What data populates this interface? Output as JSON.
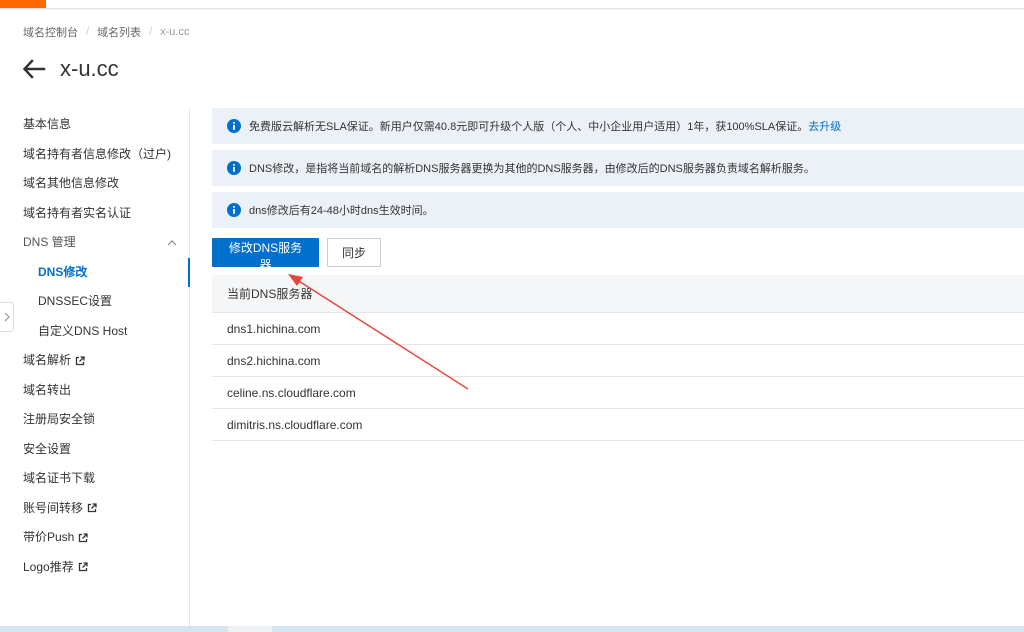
{
  "breadcrumb": {
    "items": [
      "域名控制台",
      "域名列表",
      "x-u.cc"
    ]
  },
  "page": {
    "title": "x-u.cc"
  },
  "sidebar": {
    "items": [
      {
        "label": "基本信息"
      },
      {
        "label": "域名持有者信息修改（过户)"
      },
      {
        "label": "域名其他信息修改"
      },
      {
        "label": "域名持有者实名认证"
      },
      {
        "label": "DNS 管理"
      },
      {
        "label": "DNS修改"
      },
      {
        "label": "DNSSEC设置"
      },
      {
        "label": "自定义DNS Host"
      },
      {
        "label": "域名解析"
      },
      {
        "label": "域名转出"
      },
      {
        "label": "注册局安全锁"
      },
      {
        "label": "安全设置"
      },
      {
        "label": "域名证书下载"
      },
      {
        "label": "账号间转移"
      },
      {
        "label": "带价Push"
      },
      {
        "label": "Logo推荐"
      }
    ]
  },
  "notices": {
    "n1_text": "免费版云解析无SLA保证。新用户仅需40.8元即可升级个人版（个人、中小企业用户适用）1年，获100%SLA保证。",
    "n1_link": "去升级",
    "n2_text": "DNS修改，是指将当前域名的解析DNS服务器更换为其他的DNS服务器，由修改后的DNS服务器负责域名解析服务。",
    "n3_text": "dns修改后有24-48小时dns生效时间。"
  },
  "buttons": {
    "modify_dns": "修改DNS服务器",
    "sync": "同步"
  },
  "table": {
    "header": "当前DNS服务器",
    "rows": [
      "dns1.hichina.com",
      "dns2.hichina.com",
      "celine.ns.cloudflare.com",
      "dimitris.ns.cloudflare.com"
    ]
  },
  "colors": {
    "accent": "#0070cc",
    "brand": "#ff6a00",
    "notice_bg": "#ebf1f6",
    "annotation_arrow": "#e8453c"
  }
}
